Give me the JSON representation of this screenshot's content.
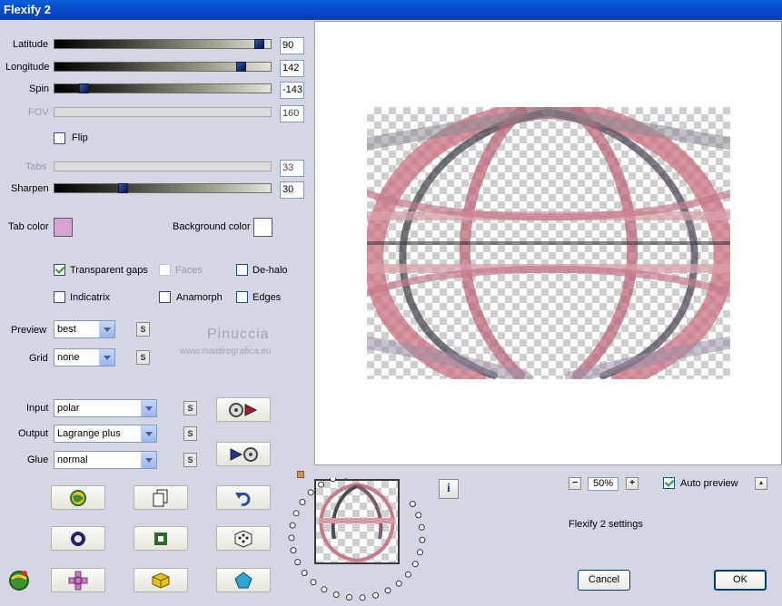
{
  "window": {
    "title": "Flexify 2"
  },
  "sliders": [
    {
      "label": "Latitude",
      "value": "90",
      "fraction": 0.97,
      "enabled": true
    },
    {
      "label": "Longitude",
      "value": "142",
      "fraction": 0.88,
      "enabled": true
    },
    {
      "label": "Spin",
      "value": "-143",
      "fraction": 0.12,
      "enabled": true
    },
    {
      "label": "FOV",
      "value": "160",
      "enabled": false
    },
    {
      "label": "Tabs",
      "value": "33",
      "enabled": false
    },
    {
      "label": "Sharpen",
      "value": "30",
      "fraction": 0.31,
      "enabled": true
    }
  ],
  "flip": {
    "label": "Flip",
    "checked": false
  },
  "colors": {
    "tab_color_label": "Tab color",
    "tab_color": "#d9a2d4",
    "background_color_label": "Background color",
    "background_color": "#ffffff"
  },
  "options": {
    "transparent_gaps": {
      "label": "Transparent gaps",
      "checked": true
    },
    "faces": {
      "label": "Faces",
      "checked": false,
      "enabled": false
    },
    "de_halo": {
      "label": "De-halo",
      "checked": false
    },
    "indicatrix": {
      "label": "Indicatrix",
      "checked": false
    },
    "anamorph": {
      "label": "Anamorph",
      "checked": false
    },
    "edges": {
      "label": "Edges",
      "checked": false
    }
  },
  "preview_select": {
    "label": "Preview",
    "value": "best"
  },
  "grid_select": {
    "label": "Grid",
    "value": "none"
  },
  "input_select": {
    "label": "Input",
    "value": "polar"
  },
  "output_select": {
    "label": "Output",
    "value": "Lagrange plus"
  },
  "glue_select": {
    "label": "Glue",
    "value": "normal"
  },
  "s_label": "S",
  "watermark": {
    "name": "Pinuccia",
    "url": "www.maidiregrafica.eu"
  },
  "zoom": {
    "value": "50%",
    "minus": "−",
    "plus": "+"
  },
  "auto_preview": {
    "label": "Auto preview",
    "checked": true
  },
  "up_label": "▲",
  "settings_name": "Flexify 2 settings",
  "info_label": "i",
  "buttons": {
    "cancel": "Cancel",
    "ok": "OK"
  }
}
